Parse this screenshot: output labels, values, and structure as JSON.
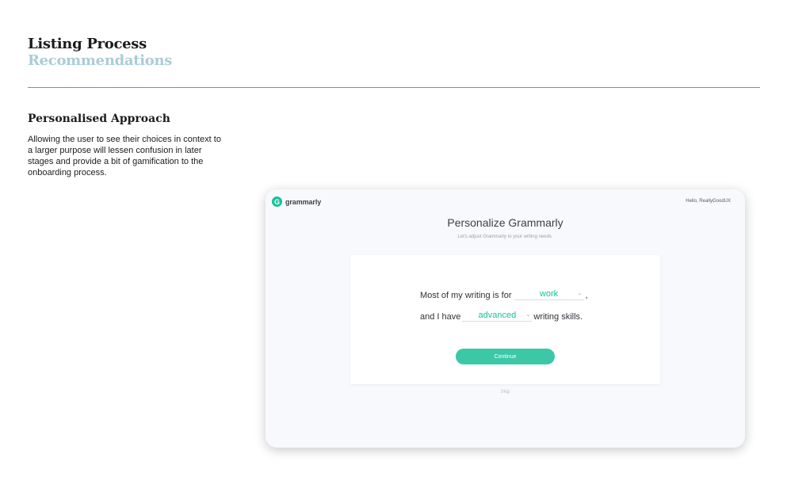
{
  "header": {
    "title": "Listing Process",
    "subtitle": "Recommendations"
  },
  "section": {
    "heading": "Personalised Approach",
    "body": "Allowing the user to see their choices in context to a larger purpose will lessen confusion in later stages and provide a bit of gamification to the onboarding process."
  },
  "app": {
    "brand": "grammarly",
    "greeting": "Hello, ReallyGoodUX",
    "title": "Personalize Grammarly",
    "subtitle": "Let's adjust Grammarly to your writing needs.",
    "sentence1_prefix": "Most of my writing is for",
    "purpose_value": "work",
    "sentence1_suffix": ",",
    "sentence2_prefix": "and I have",
    "level_value": "advanced",
    "sentence2_suffix": "writing skills.",
    "continue_label": "Continue",
    "skip_label": "Skip"
  },
  "colors": {
    "accent": "#15c39a",
    "subtitle": "#a9cdd7"
  }
}
